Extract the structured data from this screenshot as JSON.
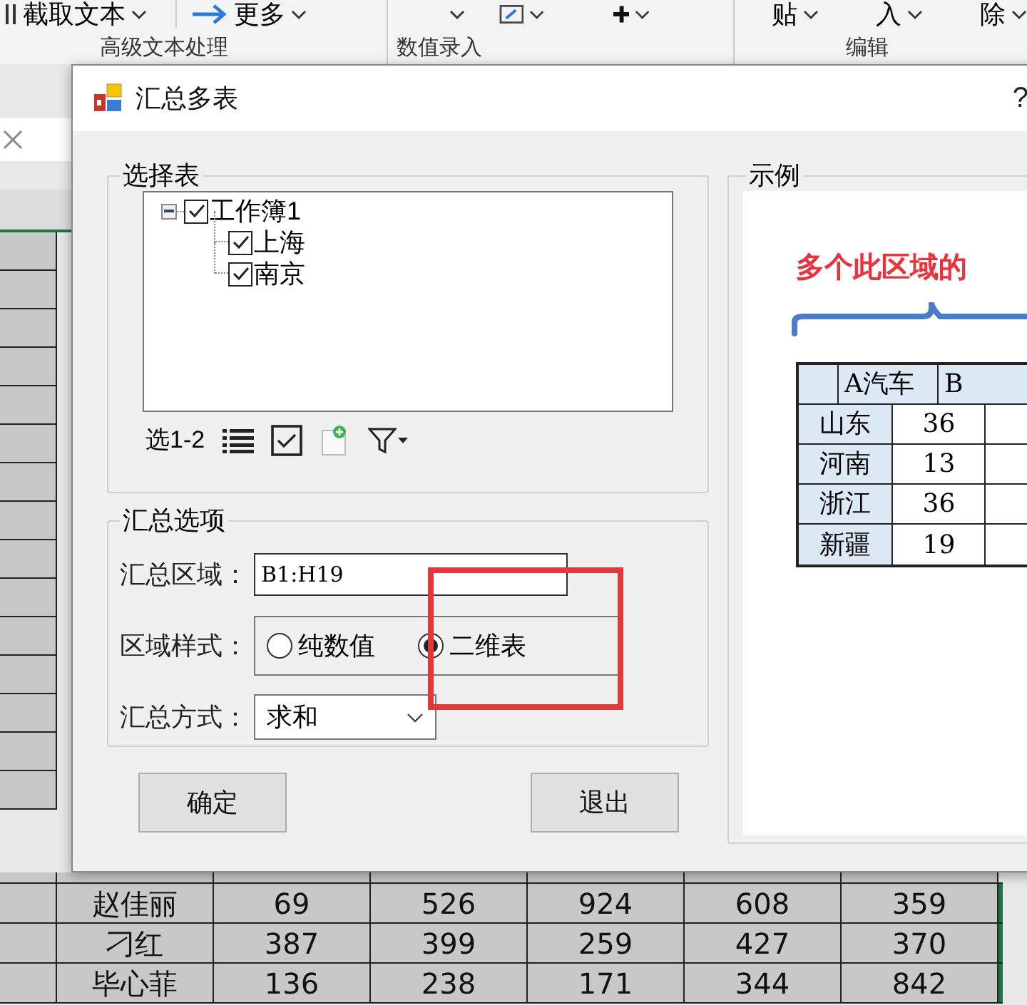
{
  "ribbon": {
    "buttons": [
      {
        "label": "截取文本"
      },
      {
        "label": "更多"
      }
    ],
    "cut_buttons": [
      "贴",
      "入",
      "除"
    ],
    "groups": [
      "高级文本处理",
      "数值录入",
      "编辑"
    ]
  },
  "sheet": {
    "rows": [
      {
        "cells": [
          "赵佳丽",
          "69",
          "526",
          "924",
          "608",
          "359"
        ]
      },
      {
        "cells": [
          "刁红",
          "387",
          "399",
          "259",
          "427",
          "370"
        ]
      },
      {
        "cells": [
          "毕心菲",
          "136",
          "238",
          "171",
          "344",
          "842"
        ]
      }
    ]
  },
  "dialog": {
    "title": "汇总多表",
    "help": "?",
    "select_group": {
      "title": "选择表",
      "tree": [
        {
          "label": "工作簿1",
          "checked": true,
          "expanded": true,
          "children": [
            {
              "label": "上海",
              "checked": true
            },
            {
              "label": "南京",
              "checked": true
            }
          ]
        }
      ],
      "toolbar_label": "选1-2"
    },
    "options_group": {
      "title": "汇总选项",
      "fields": [
        {
          "kind": "input",
          "label": "汇总区域：",
          "value": "B1:H19"
        },
        {
          "kind": "radio",
          "label": "区域样式：",
          "options": [
            {
              "label": "纯数值",
              "selected": false
            },
            {
              "label": "二维表",
              "selected": true
            }
          ]
        },
        {
          "kind": "select",
          "label": "汇总方式：",
          "value": "求和"
        }
      ]
    },
    "buttons": [
      "确定",
      "退出"
    ],
    "example": {
      "title": "示例",
      "caption": "多个此区域的",
      "table": {
        "columns": [
          "A汽车",
          "B"
        ],
        "rows": [
          {
            "label": "山东",
            "cells": [
              "36"
            ]
          },
          {
            "label": "河南",
            "cells": [
              "13"
            ]
          },
          {
            "label": "浙江",
            "cells": [
              "36"
            ]
          },
          {
            "label": "新疆",
            "cells": [
              "19"
            ]
          }
        ]
      }
    }
  }
}
